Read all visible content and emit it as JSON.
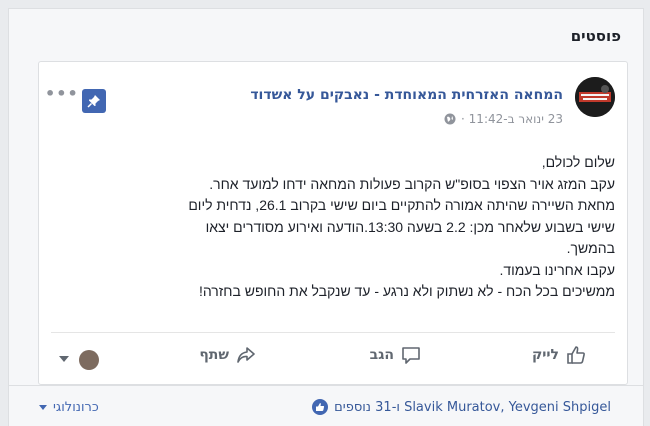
{
  "section": {
    "title": "פוסטים"
  },
  "post": {
    "page_name": "המחאה האזרחית המאוחדת - נאבקים על אשדוד",
    "timestamp": "23 ינואר ב-11:42 ·",
    "text_lines": [
      "שלום לכולם,",
      "עקב המזג אויר הצפוי בסופ\"ש הקרוב פעולות המחאה ידחו למועד אחר.",
      "מחאת השיירה שהיתה אמורה להתקיים ביום שישי בקרוב 26.1, נדחית ליום",
      "שישי בשבוע שלאחר מכן: 2.2 בשעה 13:30.הודעה ואירוע מסודרים יצאו",
      "בהמשך.",
      "עקבו אחרינו בעמוד.",
      "ממשיכים בכל הכח - לא נשתוק ולא נרגע - עד שנקבל את החופש בחזרה!"
    ],
    "actions": {
      "like": "לייק",
      "comment": "הגב",
      "share": "שתף"
    },
    "icons": {
      "pin": "pin-icon",
      "more": "more-options-icon",
      "globe": "globe-icon"
    }
  },
  "likes": {
    "text": "Slavik Muratov, Yevgeni Shpigel ו-31 נוספים",
    "sort_label": "כרונולוגי"
  },
  "colors": {
    "link": "#365899",
    "brand": "#4267b2"
  }
}
